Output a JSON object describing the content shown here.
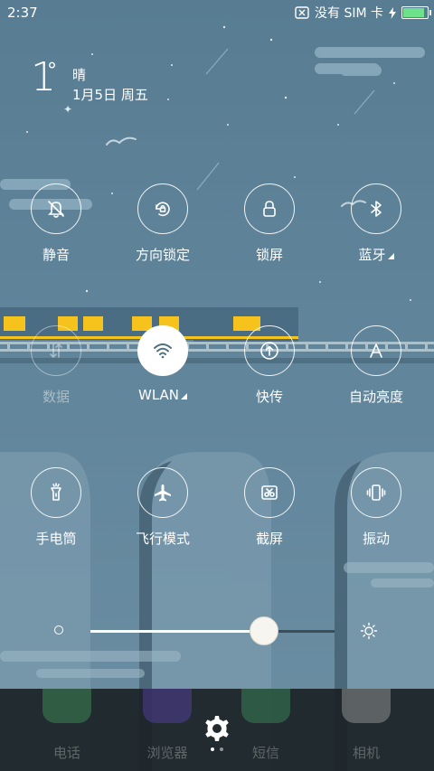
{
  "status_bar": {
    "time": "2:37",
    "sim_status": "没有 SIM 卡",
    "battery_level": 0.95
  },
  "weather": {
    "temperature": "1",
    "unit": "°",
    "condition": "晴",
    "date": "1月5日 周五"
  },
  "toggles": [
    {
      "label": "静音",
      "icon": "bell-off-icon",
      "state": "off",
      "has_more": false
    },
    {
      "label": "方向锁定",
      "icon": "rotation-lock-icon",
      "state": "off",
      "has_more": false
    },
    {
      "label": "锁屏",
      "icon": "lock-icon",
      "state": "off",
      "has_more": false
    },
    {
      "label": "蓝牙",
      "icon": "bluetooth-icon",
      "state": "off",
      "has_more": true
    },
    {
      "label": "数据",
      "icon": "mobile-data-icon",
      "state": "disabled",
      "has_more": false
    },
    {
      "label": "WLAN",
      "icon": "wifi-icon",
      "state": "on",
      "has_more": true
    },
    {
      "label": "快传",
      "icon": "quick-share-icon",
      "state": "off",
      "has_more": false
    },
    {
      "label": "自动亮度",
      "icon": "auto-brightness-icon",
      "state": "off",
      "has_more": false
    },
    {
      "label": "手电筒",
      "icon": "flashlight-icon",
      "state": "off",
      "has_more": false
    },
    {
      "label": "飞行模式",
      "icon": "airplane-icon",
      "state": "off",
      "has_more": false
    },
    {
      "label": "截屏",
      "icon": "screenshot-icon",
      "state": "off",
      "has_more": false
    },
    {
      "label": "振动",
      "icon": "vibrate-icon",
      "state": "off",
      "has_more": false
    }
  ],
  "brightness": {
    "level": 0.71
  },
  "dock": {
    "apps": [
      {
        "label": "电话",
        "icon": "phone-icon",
        "color": "#4bb86a"
      },
      {
        "label": "浏览器",
        "icon": "browser-icon",
        "color": "#6b4bd0"
      },
      {
        "label": "短信",
        "icon": "sms-icon",
        "color": "#44b06e"
      },
      {
        "label": "相机",
        "icon": "camera-icon",
        "color": "#c8c8c8"
      }
    ],
    "page_count": 2,
    "current_page": 1
  },
  "colors": {
    "sky": "#5d8196",
    "train_yellow": "#f5c31b",
    "slider_track": "#3d4d58"
  }
}
